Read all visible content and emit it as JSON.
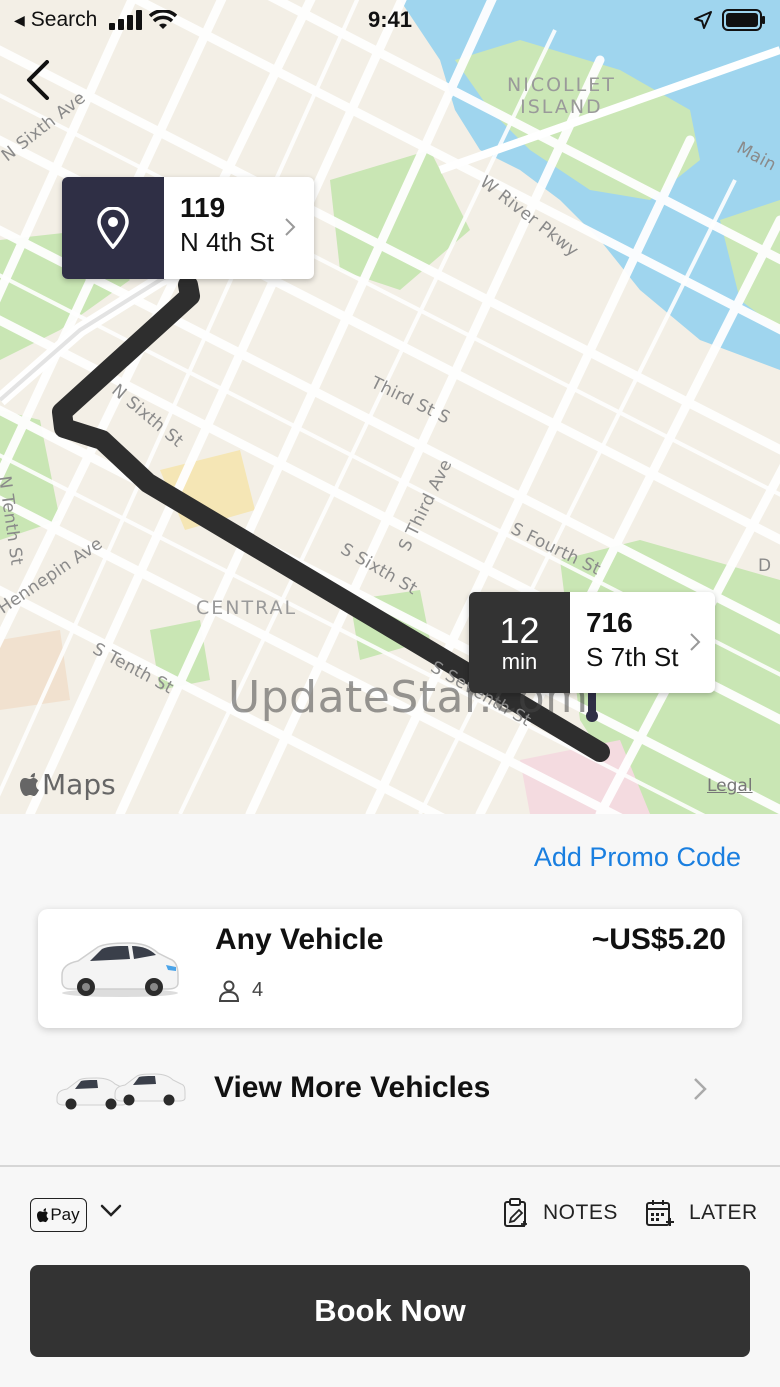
{
  "status_bar": {
    "back_label": "Search",
    "time": "9:41"
  },
  "map": {
    "district_labels": {
      "nicollet_island": "NICOLLET\nISLAND",
      "central": "CENTRAL"
    },
    "streets": {
      "n_sixth_ave": "N Sixth Ave",
      "w_river_pkwy": "W River Pkwy",
      "main": "Main",
      "n_sixth_st": "N Sixth St",
      "third_st_s": "Third St S",
      "n_tenth_st": "N Tenth St",
      "s_third_ave": "S Third Ave",
      "s_fourth_st": "S Fourth St",
      "hennepin_ave": "Hennepin Ave",
      "s_sixth_st": "S Sixth St",
      "s_tenth_st": "S Tenth St",
      "s_seventh_st": "S Seventh St",
      "d": "D"
    },
    "watermark": "UpdateStar.com",
    "maps_logo": "Maps",
    "legal": "Legal",
    "route_color": "#2e2e2e"
  },
  "pickup": {
    "number": "119",
    "street": "N 4th St",
    "icon": "location-pin-icon"
  },
  "dropoff": {
    "eta_value": "12",
    "eta_unit": "min",
    "number": "716",
    "street": "S 7th St"
  },
  "sheet": {
    "promo_label": "Add Promo Code",
    "vehicle": {
      "name": "Any Vehicle",
      "price": "~US$5.20",
      "seats": "4"
    },
    "more_vehicles_label": "View More Vehicles",
    "payment": {
      "method": "Pay",
      "notes_label": "NOTES",
      "later_label": "LATER"
    },
    "book_label": "Book Now"
  },
  "colors": {
    "accent": "#1a7fe0",
    "dark_button": "#333333",
    "pickup_badge": "#2f2f45",
    "water": "#9fd5ee",
    "park": "#c6e6b2"
  }
}
